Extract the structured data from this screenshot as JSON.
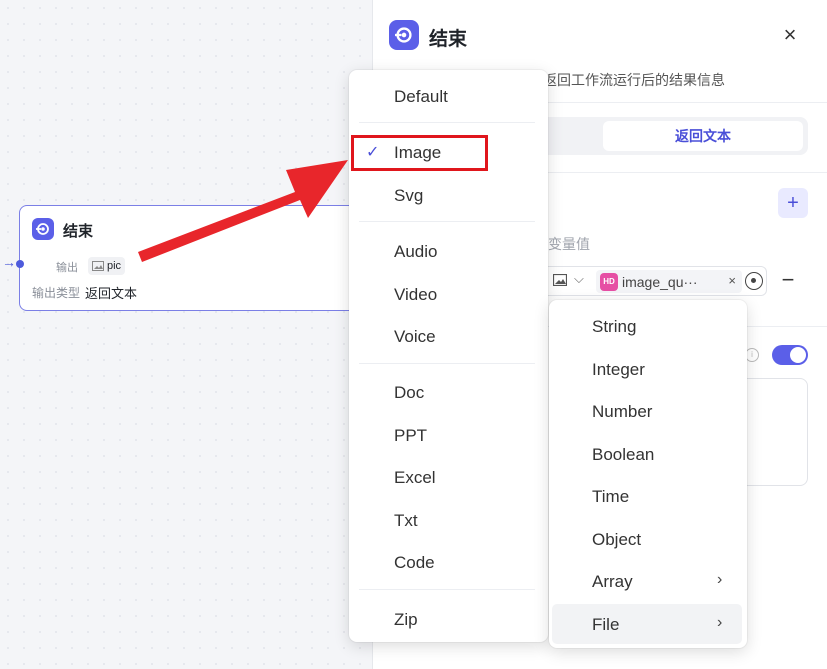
{
  "node": {
    "title": "结束",
    "output_label": "输出",
    "output_tag": "pic",
    "output_type_label": "输出类型",
    "output_type_value": "返回文本",
    "icon": "end-node-icon"
  },
  "panel": {
    "title": "结束",
    "close_icon": "×",
    "description": "返回工作流运行后的结果信息",
    "segment_active": "返回文本",
    "add_icon": "+",
    "var_label": "变量值",
    "var_tag_text": "image_qu···",
    "var_tag_close": "×",
    "minus_icon": "−",
    "info_icon": "i",
    "hd_badge": "HD"
  },
  "type_menu": {
    "items": [
      {
        "label": "Default"
      },
      {
        "label": "Image",
        "checked": true
      },
      {
        "label": "Svg"
      },
      {
        "label": "Audio"
      },
      {
        "label": "Video"
      },
      {
        "label": "Voice"
      },
      {
        "label": "Doc"
      },
      {
        "label": "PPT"
      },
      {
        "label": "Excel"
      },
      {
        "label": "Txt"
      },
      {
        "label": "Code"
      },
      {
        "label": "Zip"
      }
    ],
    "check_mark": "✓"
  },
  "var_type_menu": {
    "items": [
      {
        "label": "String"
      },
      {
        "label": "Integer"
      },
      {
        "label": "Number"
      },
      {
        "label": "Boolean"
      },
      {
        "label": "Time"
      },
      {
        "label": "Object"
      },
      {
        "label": "Array",
        "has_submenu": true
      },
      {
        "label": "File",
        "has_submenu": true,
        "active": true
      }
    ],
    "submenu_arrow": "›"
  },
  "colors": {
    "accent": "#5b5fe8",
    "annotation_red": "#e0161c",
    "hd_pink": "#e64fa4"
  }
}
